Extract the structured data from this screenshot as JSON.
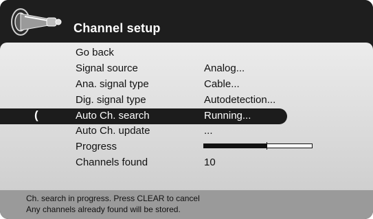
{
  "header": {
    "title": "Channel setup",
    "icon": "satellite-dish-icon"
  },
  "menu": {
    "go_back": {
      "label": "Go back"
    },
    "signal_source": {
      "label": "Signal source",
      "value": "Analog..."
    },
    "ana_signal_type": {
      "label": "Ana. signal type",
      "value": "Cable..."
    },
    "dig_signal_type": {
      "label": "Dig. signal type",
      "value": "Autodetection..."
    },
    "auto_ch_search": {
      "label": "Auto Ch. search",
      "value": "Running...",
      "cursor": "("
    },
    "auto_ch_update": {
      "label": "Auto Ch. update",
      "value": "..."
    },
    "progress": {
      "label": "Progress",
      "fraction": 0.58
    },
    "channels_found": {
      "label": "Channels found",
      "value": "10"
    }
  },
  "footer": {
    "line1": "Ch. search in progress. Press CLEAR to cancel",
    "line2": "Any channels already found will be stored."
  },
  "colors": {
    "background": "#1e1e1e",
    "panel": "#dcdcdc",
    "footer": "#9a9a9a",
    "selected": "#1c1c1c"
  }
}
